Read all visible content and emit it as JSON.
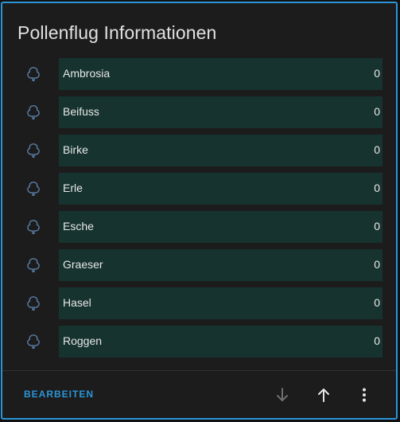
{
  "card": {
    "title": "Pollenflug Informationen",
    "accent_color": "#2b95d8",
    "row_bar_color": "#16332f",
    "icon_color": "#5a7fa8"
  },
  "entities": [
    {
      "name": "Ambrosia",
      "value": "0",
      "icon": "tree-outline-icon"
    },
    {
      "name": "Beifuss",
      "value": "0",
      "icon": "tree-outline-icon"
    },
    {
      "name": "Birke",
      "value": "0",
      "icon": "tree-outline-icon"
    },
    {
      "name": "Erle",
      "value": "0",
      "icon": "tree-outline-icon"
    },
    {
      "name": "Esche",
      "value": "0",
      "icon": "tree-outline-icon"
    },
    {
      "name": "Graeser",
      "value": "0",
      "icon": "tree-outline-icon"
    },
    {
      "name": "Hasel",
      "value": "0",
      "icon": "tree-outline-icon"
    },
    {
      "name": "Roggen",
      "value": "0",
      "icon": "tree-outline-icon"
    }
  ],
  "actions": {
    "edit_label": "BEARBEITEN",
    "move_down_icon": "arrow-down-icon",
    "move_up_icon": "arrow-up-icon",
    "more_icon": "dots-vertical-icon"
  }
}
